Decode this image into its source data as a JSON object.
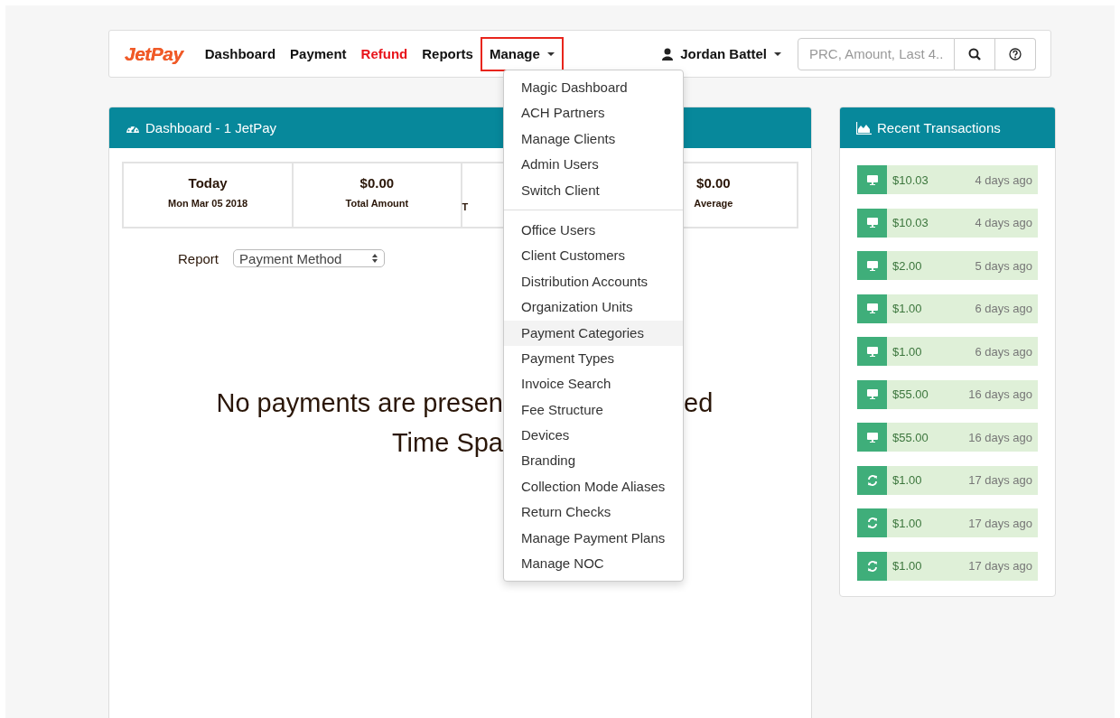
{
  "navbar": {
    "logo": "JetPay",
    "links": [
      {
        "label": "Dashboard",
        "selected": false,
        "kind": "plain"
      },
      {
        "label": "Payment",
        "selected": false,
        "kind": "plain"
      },
      {
        "label": "Refund",
        "selected": false,
        "kind": "alert"
      },
      {
        "label": "Reports",
        "selected": false,
        "kind": "plain"
      },
      {
        "label": "Manage",
        "selected": true,
        "kind": "dropdown"
      }
    ],
    "user": "Jordan Battel",
    "search": {
      "placeholder": "PRC, Amount, Last 4.."
    }
  },
  "manage_menu": {
    "groups": [
      {
        "items": [
          {
            "label": "Magic Dashboard",
            "selected": false
          },
          {
            "label": "ACH Partners",
            "selected": false
          },
          {
            "label": "Manage Clients",
            "selected": false
          },
          {
            "label": "Admin Users",
            "selected": false
          },
          {
            "label": "Switch Client",
            "selected": false
          }
        ]
      },
      {
        "items": [
          {
            "label": "Office Users",
            "selected": false
          },
          {
            "label": "Client Customers",
            "selected": false
          },
          {
            "label": "Distribution Accounts",
            "selected": false
          },
          {
            "label": "Organization Units",
            "selected": false
          },
          {
            "label": "Payment Categories",
            "selected": true
          },
          {
            "label": "Payment Types",
            "selected": false
          },
          {
            "label": "Invoice Search",
            "selected": false
          },
          {
            "label": "Fee Structure",
            "selected": false
          },
          {
            "label": "Devices",
            "selected": false
          },
          {
            "label": "Branding",
            "selected": false
          },
          {
            "label": "Collection Mode Aliases",
            "selected": false
          },
          {
            "label": "Return Checks",
            "selected": false
          },
          {
            "label": "Manage Payment Plans",
            "selected": false
          },
          {
            "label": "Manage NOC",
            "selected": false
          }
        ]
      }
    ]
  },
  "dashboard": {
    "title": "Dashboard - 1 JetPay",
    "stats": [
      {
        "value": "Today",
        "label": "Mon Mar 05 2018"
      },
      {
        "value": "$0.00",
        "label": "Total Amount"
      },
      {
        "label": "T"
      },
      {
        "value": "$0.00",
        "label": "Average"
      }
    ],
    "report": {
      "label": "Report",
      "value": "Payment Method"
    },
    "message": {
      "line_1_start": "No payments are presen",
      "line_1_end": "ed",
      "line_2_start": "Time Spa"
    }
  },
  "recent_transactions": {
    "title": "Recent Transactions",
    "items": [
      {
        "kind": "terminal",
        "amount": "$10.03",
        "time": "4 days ago"
      },
      {
        "kind": "terminal",
        "amount": "$10.03",
        "time": "4 days ago"
      },
      {
        "kind": "terminal",
        "amount": "$2.00",
        "time": "5 days ago"
      },
      {
        "kind": "terminal",
        "amount": "$1.00",
        "time": "6 days ago"
      },
      {
        "kind": "terminal",
        "amount": "$1.00",
        "time": "6 days ago"
      },
      {
        "kind": "terminal",
        "amount": "$55.00",
        "time": "16 days ago"
      },
      {
        "kind": "terminal",
        "amount": "$55.00",
        "time": "16 days ago"
      },
      {
        "kind": "recurring",
        "amount": "$1.00",
        "time": "17 days ago"
      },
      {
        "kind": "recurring",
        "amount": "$1.00",
        "time": "17 days ago"
      },
      {
        "kind": "recurring",
        "amount": "$1.00",
        "time": "17 days ago"
      }
    ]
  }
}
